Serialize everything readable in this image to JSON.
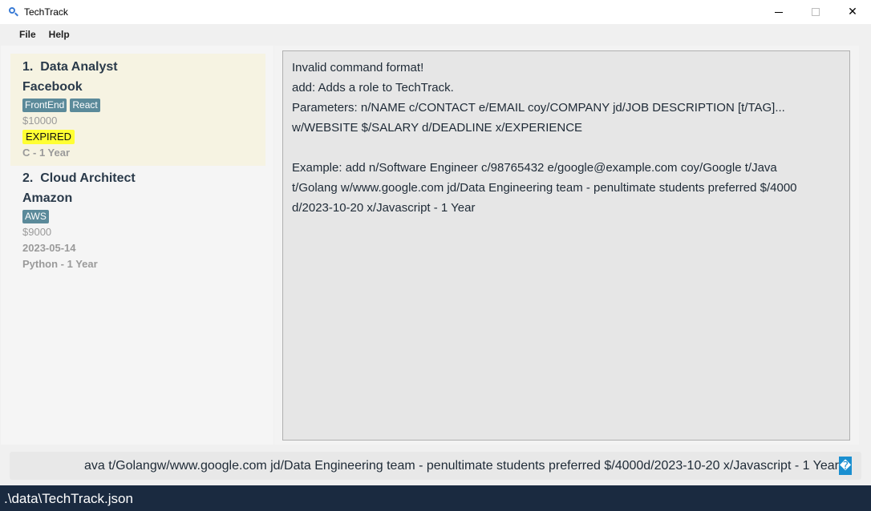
{
  "window": {
    "title": "TechTrack",
    "icon": "magnifier-icon",
    "controls": {
      "minimize": "minimize-icon",
      "maximize": "maximize-icon",
      "close": "✕"
    }
  },
  "menu": {
    "file": "File",
    "help": "Help"
  },
  "roles": [
    {
      "index": "1.",
      "title": "Data Analyst",
      "company": "Facebook",
      "tags": [
        "FrontEnd",
        "React"
      ],
      "salary": "$10000",
      "deadline": "EXPIRED",
      "experience": "C - 1 Year",
      "selected": true
    },
    {
      "index": "2.",
      "title": "Cloud Architect",
      "company": "Amazon",
      "tags": [
        "AWS"
      ],
      "salary": "$9000",
      "deadline": "2023-05-14",
      "experience": "Python - 1 Year",
      "selected": false
    }
  ],
  "result": {
    "lines": [
      "Invalid command format!",
      "add: Adds a role to TechTrack.",
      "Parameters: n/NAME c/CONTACT e/EMAIL coy/COMPANY jd/JOB DESCRIPTION [t/TAG]...",
      "w/WEBSITE $/SALARY d/DEADLINE x/EXPERIENCE",
      "",
      "Example: add n/Software Engineer c/98765432 e/google@example.com coy/Google t/Java",
      "t/Golang w/www.google.com jd/Data Engineering team - penultimate students preferred $/4000",
      "d/2023-10-20 x/Javascript - 1 Year"
    ]
  },
  "command": {
    "value": "ava t/Golangw/www.google.com jd/Data Engineering team - penultimate students preferred $/4000d/2023-10-20 x/Javascript - 1 Year",
    "cursor_glyph": "�"
  },
  "status": {
    "file_path": ".\\data\\TechTrack.json"
  },
  "colors": {
    "selected_card": "#f6f3e2",
    "tag": "#5b8a9a",
    "expired_highlight": "#ffff33",
    "status_bar": "#1a2a40",
    "cursor": "#1a8fd0"
  }
}
